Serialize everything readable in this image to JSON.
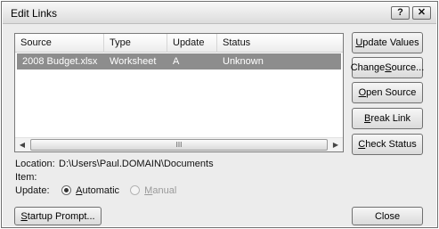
{
  "window": {
    "title": "Edit Links",
    "help_glyph": "?",
    "close_glyph": "✕"
  },
  "links_table": {
    "columns": [
      "Source",
      "Type",
      "Update",
      "Status"
    ],
    "rows": [
      {
        "source": "2008 Budget.xlsx",
        "type": "Worksheet",
        "update": "A",
        "status": "Unknown"
      }
    ],
    "scroll_left_glyph": "◀",
    "scroll_right_glyph": "▶",
    "scroll_thumb_grip": "III"
  },
  "buttons": {
    "update_values": {
      "pre": "",
      "key": "U",
      "post": "pdate Values"
    },
    "change_source": {
      "pre": "Change ",
      "key": "S",
      "post": "ource..."
    },
    "open_source": {
      "pre": "",
      "key": "O",
      "post": "pen Source"
    },
    "break_link": {
      "pre": "",
      "key": "B",
      "post": "reak Link"
    },
    "check_status": {
      "pre": "",
      "key": "C",
      "post": "heck Status"
    },
    "startup_prompt": {
      "pre": "",
      "key": "S",
      "post": "tartup Prompt..."
    },
    "close": "Close"
  },
  "details": {
    "location_label": "Location:",
    "location_value": "D:\\Users\\Paul.DOMAIN\\Documents",
    "item_label": "Item:",
    "item_value": "",
    "update_label": "Update:",
    "automatic": {
      "pre": "",
      "key": "A",
      "post": "utomatic",
      "selected": true
    },
    "manual": {
      "pre": "",
      "key": "M",
      "post": "anual",
      "enabled": false
    }
  }
}
